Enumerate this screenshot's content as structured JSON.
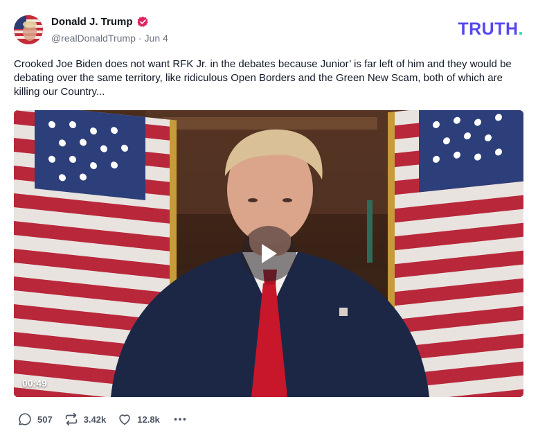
{
  "author": {
    "name": "Donald J. Trump",
    "handle": "@realDonaldTrump",
    "separator": "·",
    "date": "Jun 4"
  },
  "brand": {
    "logo_text": "TRUTH",
    "logo_dot": "."
  },
  "post": {
    "text": "Crooked Joe Biden does not want RFK Jr. in the debates because Junior’ is far left of him and they would be debating over the same territory, like ridiculous Open Borders and the Green New Scam, both of which are killing our Country..."
  },
  "video": {
    "duration": "00:49"
  },
  "actions": {
    "replies": "507",
    "retruths": "3.42k",
    "likes": "12.8k"
  },
  "colors": {
    "brand": "#5448ee",
    "brand_dot": "#1ed8a8",
    "verified": "#e0245e",
    "text_secondary": "#6b7280"
  }
}
